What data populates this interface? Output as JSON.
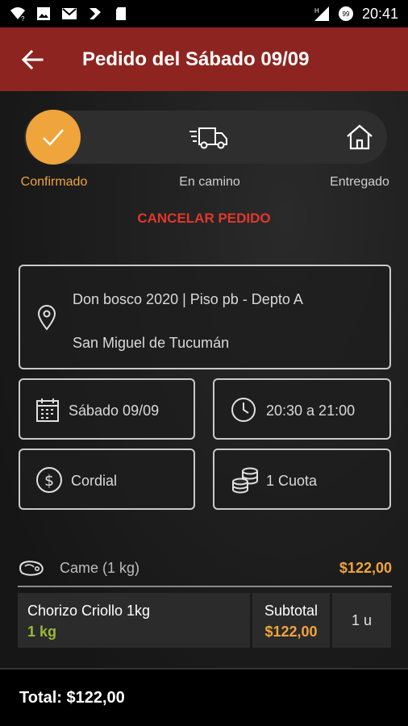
{
  "status_bar": {
    "time": "20:41",
    "signal_indicator": "H",
    "badge": "99"
  },
  "header": {
    "title": "Pedido del Sábado 09/09"
  },
  "progress": {
    "steps": [
      {
        "label": "Confirmado",
        "icon": "check-icon",
        "active": true
      },
      {
        "label": "En camino",
        "icon": "truck-icon",
        "active": false
      },
      {
        "label": "Entregado",
        "icon": "home-icon",
        "active": false
      }
    ],
    "active_color": "#f0a43c"
  },
  "cancel_label": "CANCELAR PEDIDO",
  "address": {
    "line1": "Don bosco 2020 | Piso pb - Depto A",
    "line2": "San Miguel de Tucumán"
  },
  "date": "Sábado 09/09",
  "time_range": "20:30 a 21:00",
  "payment_method": "Cordial",
  "installments": "1 Cuota",
  "category": {
    "label": "Came (1 kg)",
    "price": "$122,00"
  },
  "items": [
    {
      "name": "Chorizo Criollo 1kg",
      "qty_label": "1 kg",
      "subtotal_label": "Subtotal",
      "subtotal": "$122,00",
      "units": "1 u"
    }
  ],
  "footer": {
    "total": "Total: $122,00"
  },
  "colors": {
    "brand": "#8e2420",
    "accent": "#f0a43c",
    "cancel": "#e0382c",
    "qty": "#9bb83a"
  }
}
